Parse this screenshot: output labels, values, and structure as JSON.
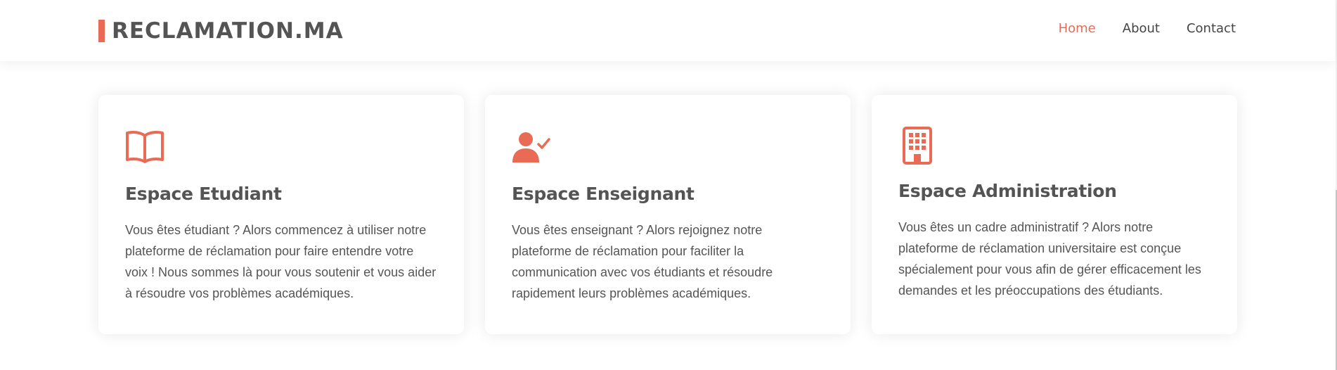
{
  "brand": {
    "name": "RECLAMATION.MA",
    "accent": "#e96b56"
  },
  "nav": [
    {
      "label": "Home",
      "active": true
    },
    {
      "label": "About",
      "active": false
    },
    {
      "label": "Contact",
      "active": false
    }
  ],
  "cards": [
    {
      "icon": "book-icon",
      "title": "Espace Etudiant",
      "text": "Vous êtes étudiant ? Alors commencez à utiliser notre plateforme de réclamation pour faire entendre votre voix ! Nous sommes là pour vous soutenir et vous aider à résoudre vos problèmes académiques."
    },
    {
      "icon": "person-check-icon",
      "title": "Espace Enseignant",
      "text": "Vous êtes enseignant ? Alors rejoignez notre plateforme de réclamation pour faciliter la communication avec vos étudiants et résoudre rapidement leurs problèmes académiques."
    },
    {
      "icon": "building-icon",
      "title": "Espace Administration",
      "text": "Vous êtes un cadre administratif ? Alors notre plateforme de réclamation universitaire est conçue spécialement pour vous afin de gérer efficacement les demandes et les préoccupations des étudiants."
    }
  ]
}
